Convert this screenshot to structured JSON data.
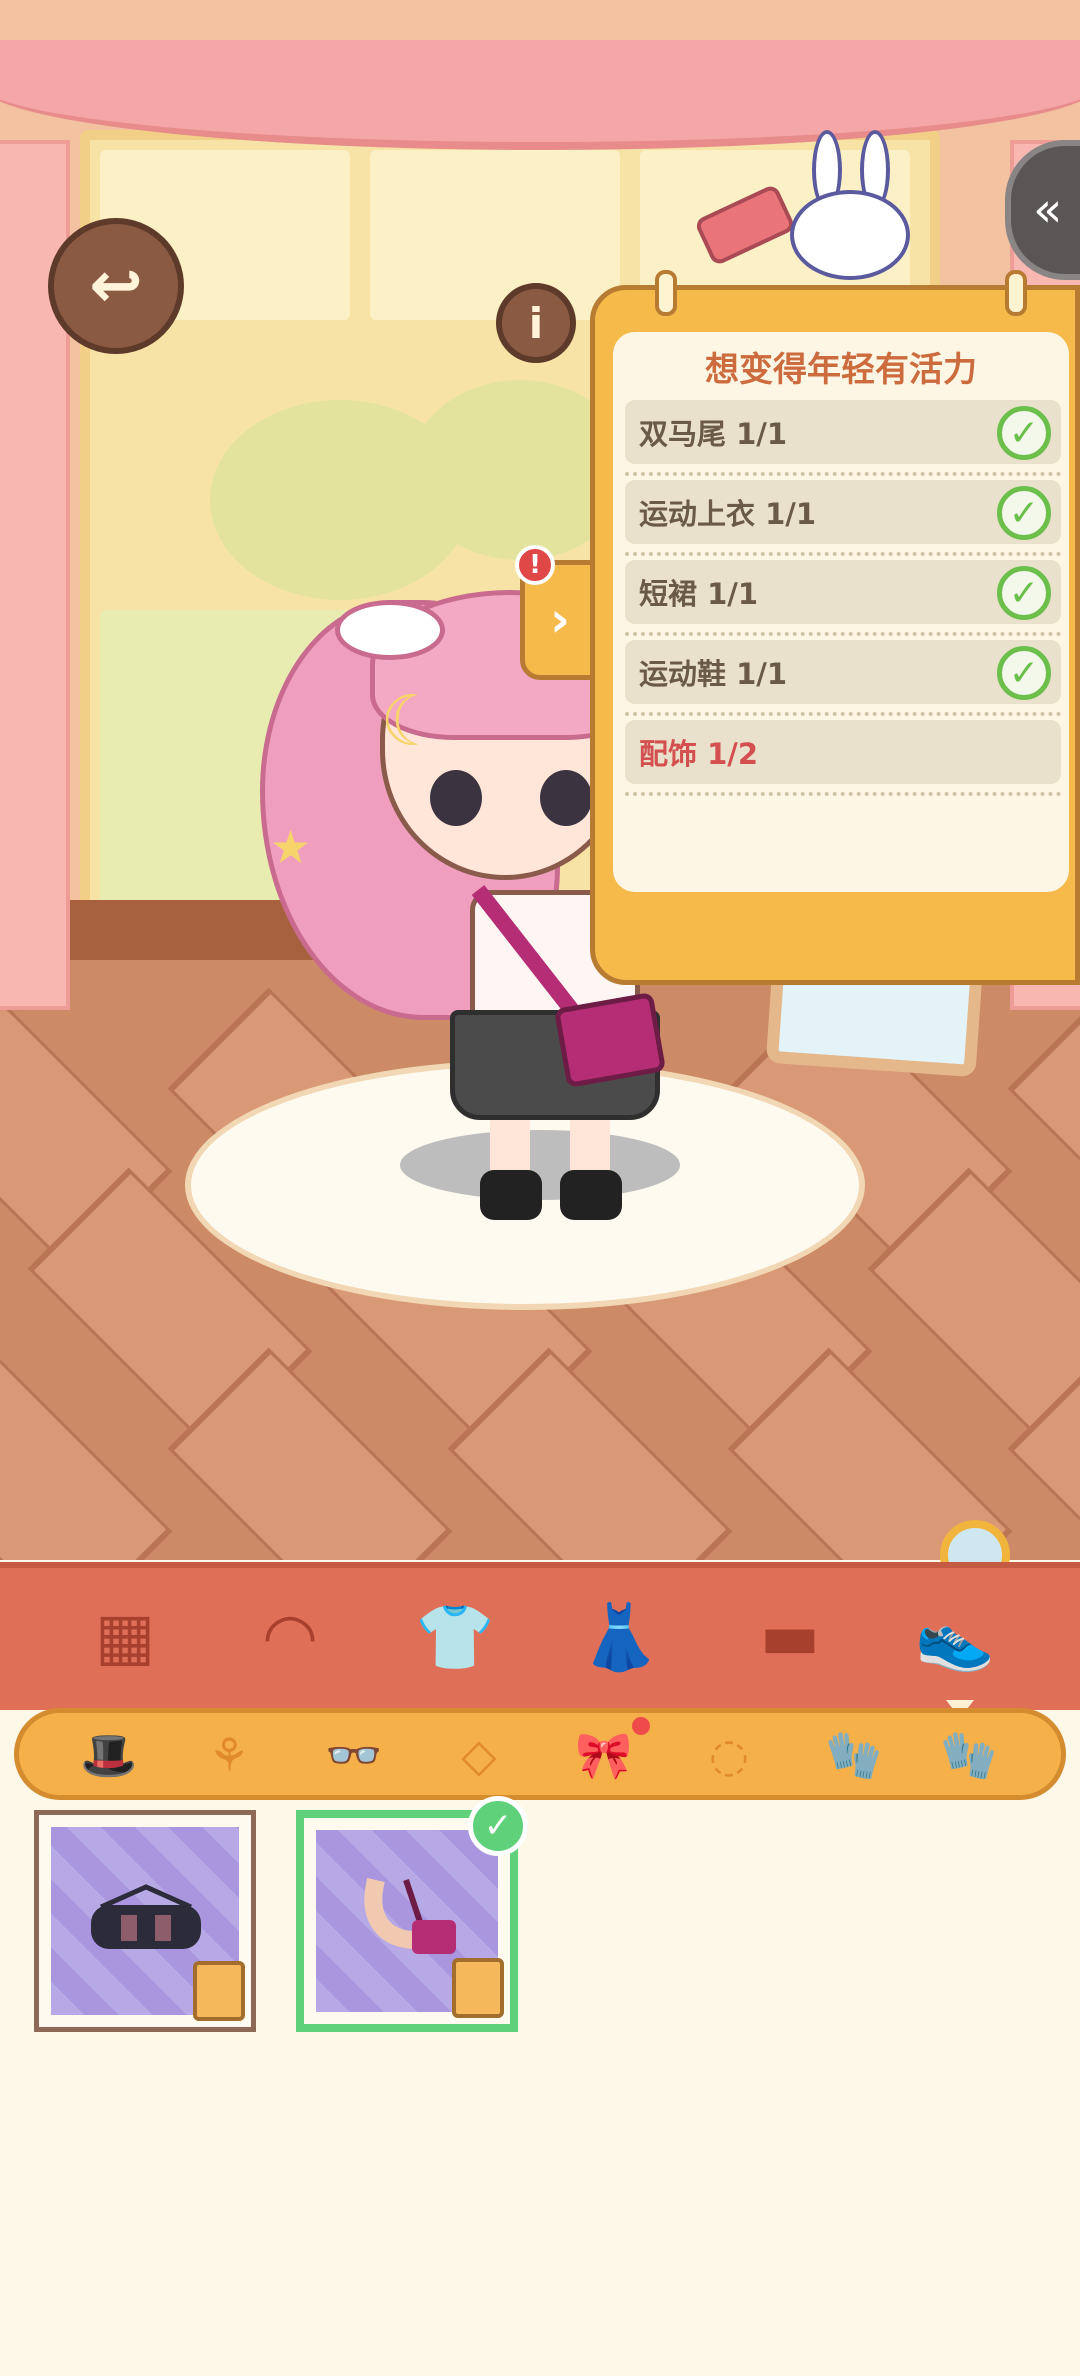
{
  "scene": {
    "back_icon": "back-arrow-icon",
    "info_icon": "info-icon",
    "info_glyph": "i",
    "side_tab_icon": "double-chevron-left-icon",
    "side_tab_glyph": "«"
  },
  "quest": {
    "title": "想变得年轻有活力",
    "rows": [
      {
        "label": "双马尾 1/1",
        "done": true
      },
      {
        "label": "运动上衣 1/1",
        "done": true
      },
      {
        "label": "短裙 1/1",
        "done": true
      },
      {
        "label": "运动鞋 1/1",
        "done": true
      },
      {
        "label": "配饰 1/2",
        "done": false
      }
    ],
    "check_glyph": "✓",
    "tab_glyph": "›",
    "alert_glyph": "!"
  },
  "categories": [
    {
      "name": "all",
      "icon": "grid-icon",
      "glyph": "▦"
    },
    {
      "name": "hair",
      "icon": "hair-icon",
      "glyph": "◠"
    },
    {
      "name": "top",
      "icon": "shirt-icon",
      "glyph": "👕"
    },
    {
      "name": "dress",
      "icon": "dress-icon",
      "glyph": "👗"
    },
    {
      "name": "bottom",
      "icon": "shorts-icon",
      "glyph": "▬"
    },
    {
      "name": "shoes",
      "icon": "shoe-icon",
      "glyph": "👟"
    }
  ],
  "subcategories": [
    {
      "name": "hat",
      "icon": "hat-icon",
      "glyph": "🎩"
    },
    {
      "name": "earrings",
      "icon": "earring-icon",
      "glyph": "⚘"
    },
    {
      "name": "glasses",
      "icon": "glasses-icon",
      "glyph": "👓"
    },
    {
      "name": "necklace",
      "icon": "necklace-icon",
      "glyph": "◇"
    },
    {
      "name": "hair-bow",
      "icon": "bow-icon",
      "glyph": "🎀",
      "active": true
    },
    {
      "name": "bracelet",
      "icon": "bracelet-icon",
      "glyph": "◌"
    },
    {
      "name": "glove",
      "icon": "mitten-icon",
      "glyph": "🧤"
    },
    {
      "name": "glove-2",
      "icon": "mitten-icon",
      "glyph": "🧤"
    }
  ],
  "items": [
    {
      "name": "duffel-bag",
      "selected": false
    },
    {
      "name": "crossbody-bag",
      "selected": true
    }
  ],
  "colors": {
    "accent": "#e06f58",
    "sub_bar": "#f6b04a",
    "quest_panel": "#f5ba4a",
    "done_check": "#6dbf4b",
    "pending_text": "#d45050"
  }
}
